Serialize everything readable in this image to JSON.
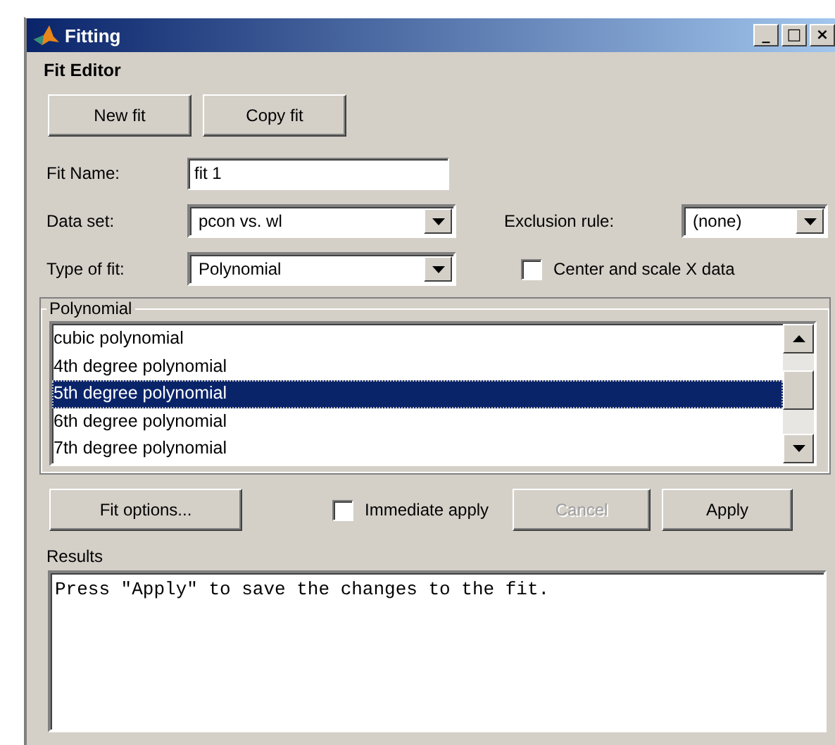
{
  "window": {
    "title": "Fitting",
    "controls": [
      "_",
      "□",
      "×"
    ]
  },
  "header": "Fit Editor",
  "top_buttons": [
    "New fit",
    "Copy fit"
  ],
  "fit_name": {
    "label": "Fit Name:",
    "value": "fit 1"
  },
  "data_set": {
    "label": "Data set:",
    "value": "pcon vs. wl"
  },
  "exclusion_rule": {
    "label": "Exclusion rule:",
    "value": "(none)"
  },
  "type_of_fit": {
    "label": "Type of fit:",
    "value": "Polynomial"
  },
  "center_scale": {
    "label": "Center and scale X data",
    "checked": false
  },
  "group": {
    "title": "Polynomial",
    "items": [
      {
        "label": "cubic polynomial",
        "selected": false
      },
      {
        "label": "4th degree polynomial",
        "selected": false
      },
      {
        "label": "5th degree polynomial",
        "selected": true
      },
      {
        "label": "6th degree polynomial",
        "selected": false
      },
      {
        "label": "7th degree polynomial",
        "selected": false
      }
    ]
  },
  "fit_options": {
    "label": "Fit options..."
  },
  "immediate_apply": {
    "label": "Immediate apply",
    "checked": false
  },
  "actions": [
    {
      "label": "Cancel",
      "disabled": true
    },
    {
      "label": "Apply",
      "disabled": false
    }
  ],
  "results": {
    "label": "Results",
    "text": "Press \"Apply\" to save the changes to the fit."
  }
}
